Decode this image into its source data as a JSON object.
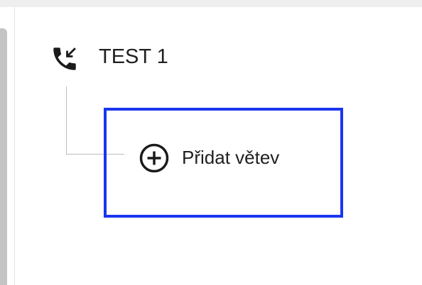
{
  "node": {
    "title": "TEST 1",
    "icon": "incoming-call-icon"
  },
  "branch": {
    "add_label": "Přidat větev",
    "icon": "plus-circle-icon",
    "highlight_color": "#1a36f0"
  }
}
